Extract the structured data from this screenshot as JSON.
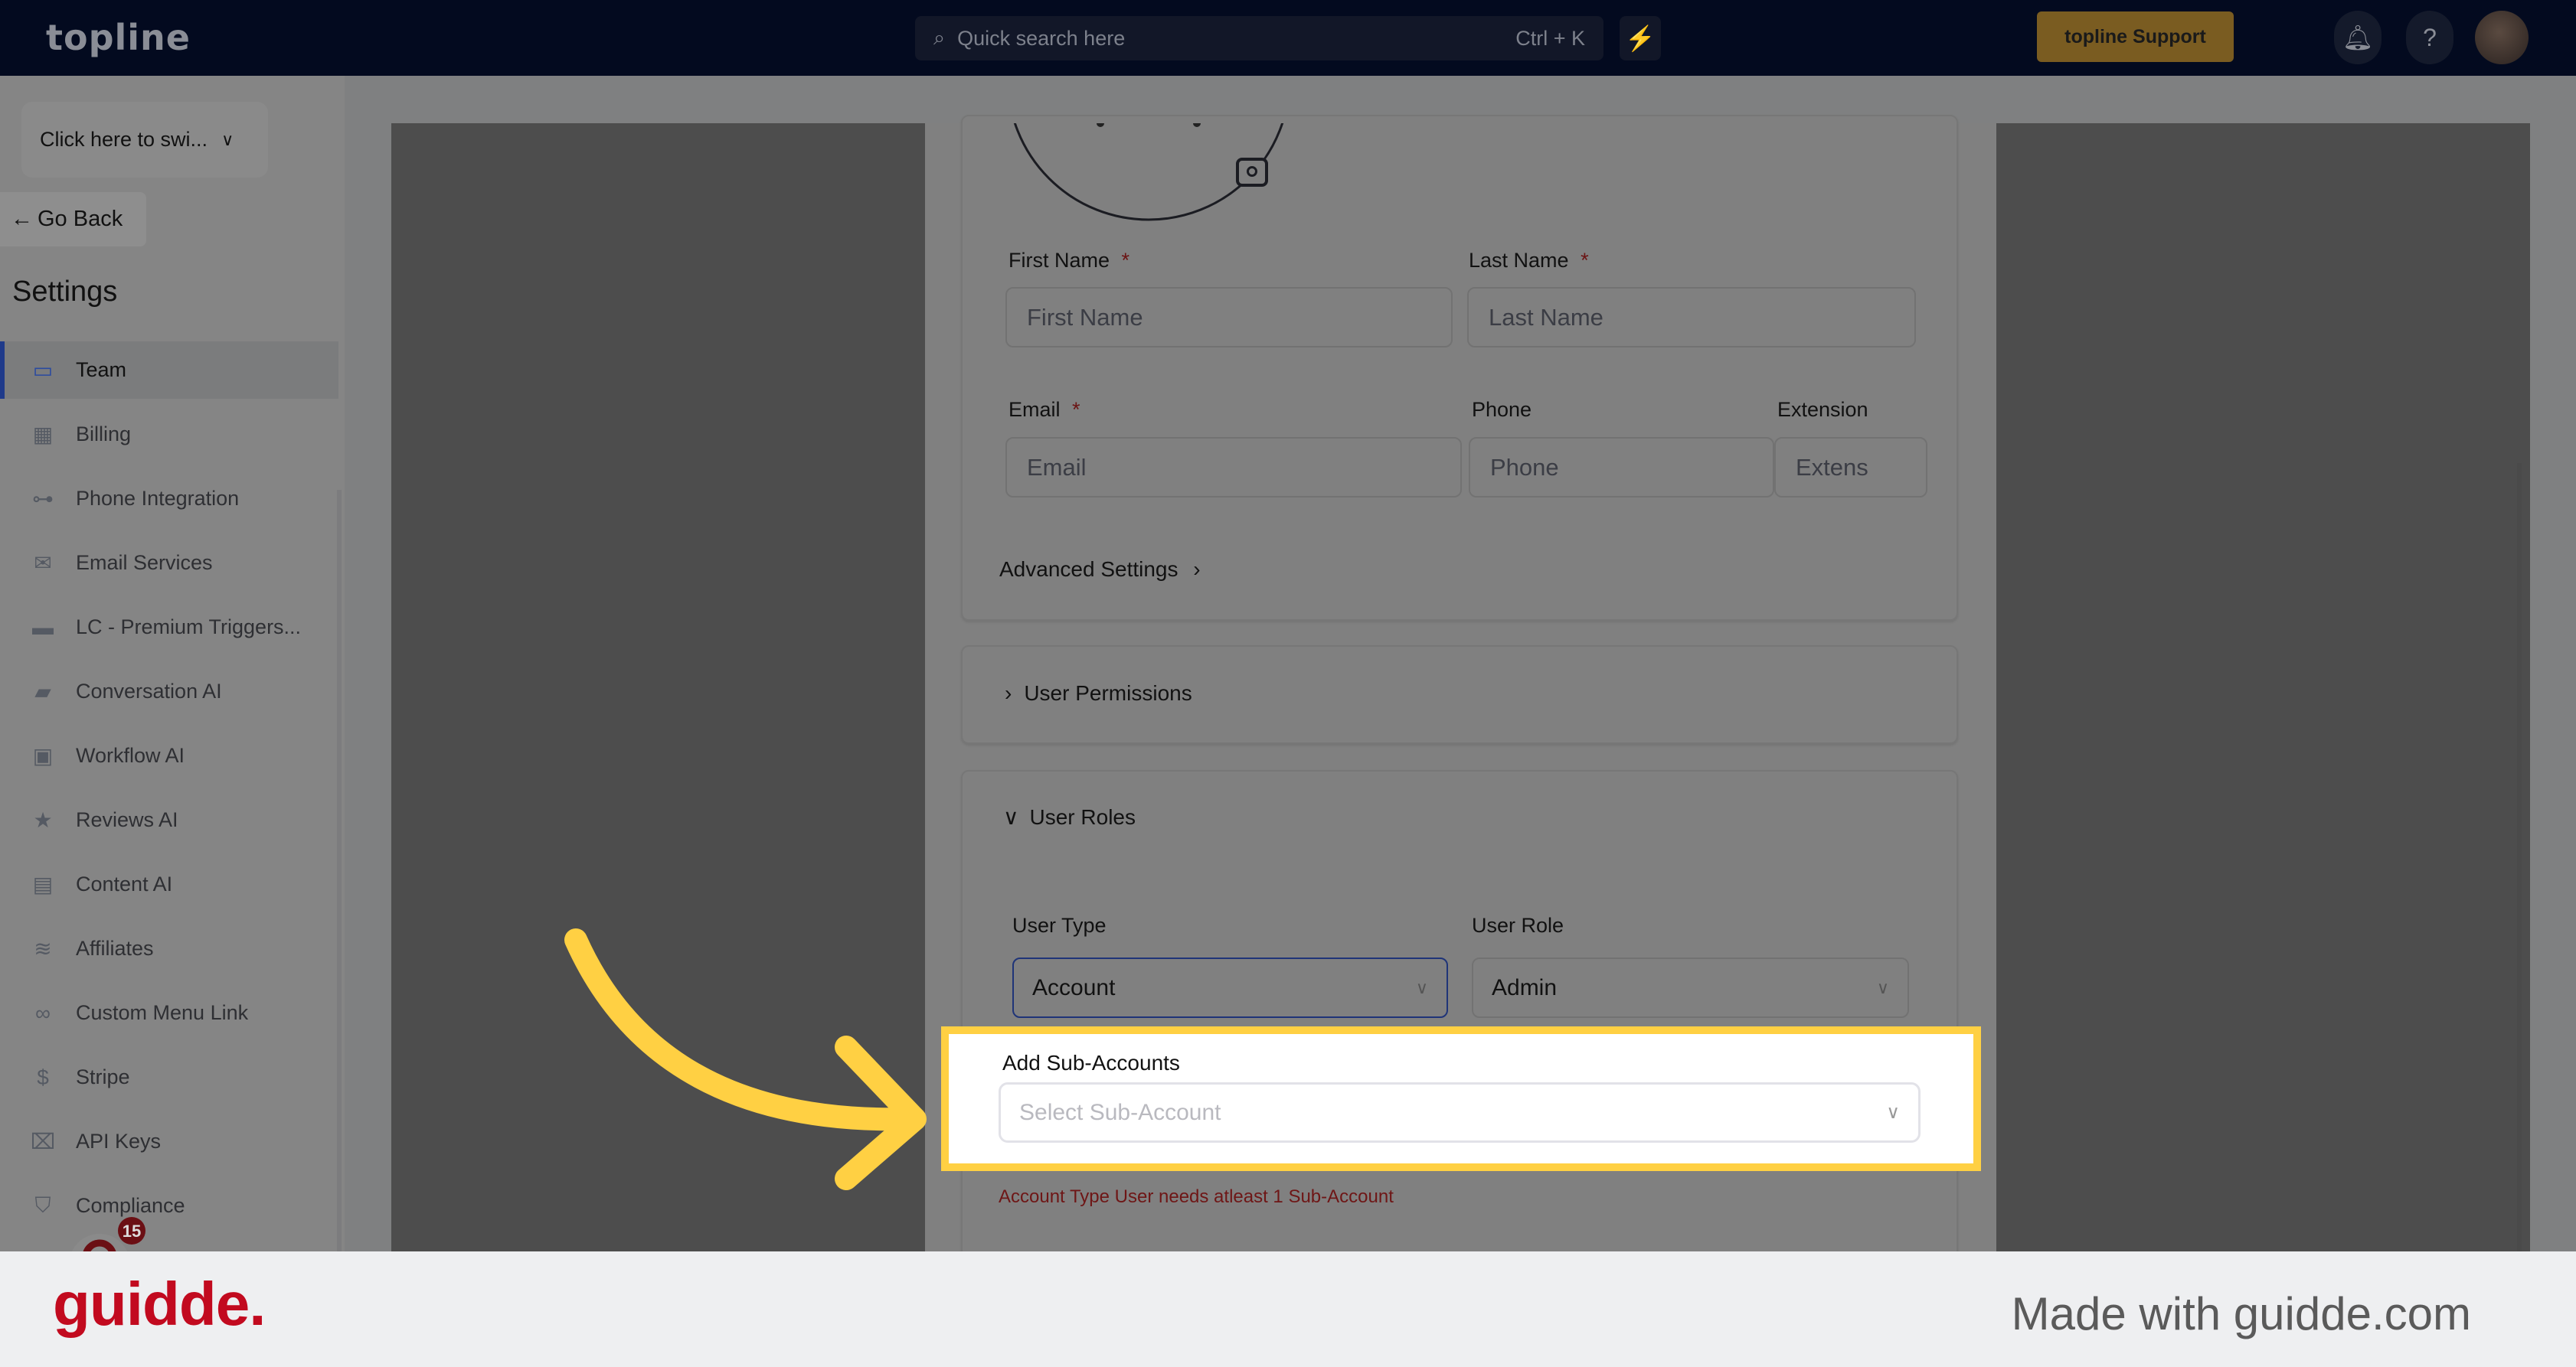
{
  "header": {
    "logo": "topline",
    "search_placeholder": "Quick search here",
    "search_shortcut": "Ctrl + K",
    "support_label": "topline Support"
  },
  "sidebar": {
    "switcher": "Click here to swi...",
    "go_back": "Go Back",
    "title": "Settings",
    "items": [
      {
        "label": "Team",
        "icon": "team-icon",
        "glyph": "▭",
        "active": true
      },
      {
        "label": "Billing",
        "icon": "calculator-icon",
        "glyph": "▦"
      },
      {
        "label": "Phone Integration",
        "icon": "integration-icon",
        "glyph": "⊶"
      },
      {
        "label": "Email Services",
        "icon": "mail-icon",
        "glyph": "✉"
      },
      {
        "label": "LC - Premium Triggers...",
        "icon": "store-icon",
        "glyph": "▬"
      },
      {
        "label": "Conversation AI",
        "icon": "chat-icon",
        "glyph": "▰"
      },
      {
        "label": "Workflow AI",
        "icon": "ai-chip-icon",
        "glyph": "▣"
      },
      {
        "label": "Reviews AI",
        "icon": "star-icon",
        "glyph": "★"
      },
      {
        "label": "Content AI",
        "icon": "content-icon",
        "glyph": "▤"
      },
      {
        "label": "Affiliates",
        "icon": "handshake-icon",
        "glyph": "≋"
      },
      {
        "label": "Custom Menu Link",
        "icon": "link-icon",
        "glyph": "∞"
      },
      {
        "label": "Stripe",
        "icon": "dollar-hand-icon",
        "glyph": "$"
      },
      {
        "label": "API Keys",
        "icon": "api-key-icon",
        "glyph": "⌧"
      },
      {
        "label": "Compliance",
        "icon": "shield-icon",
        "glyph": "⛉"
      }
    ],
    "badge_count": "15"
  },
  "form": {
    "first_name_label": "First Name",
    "first_name_placeholder": "First Name",
    "last_name_label": "Last Name",
    "last_name_placeholder": "Last Name",
    "email_label": "Email",
    "email_placeholder": "Email",
    "phone_label": "Phone",
    "phone_placeholder": "Phone",
    "extension_label": "Extension",
    "extension_placeholder": "Extens",
    "required_mark": "*",
    "advanced_settings": "Advanced Settings",
    "user_permissions": "User Permissions",
    "user_roles": "User Roles",
    "user_type_label": "User Type",
    "user_type_value": "Account",
    "user_role_label": "User Role",
    "user_role_value": "Admin",
    "sub_accounts_label": "Add Sub-Accounts",
    "sub_accounts_placeholder": "Select Sub-Account",
    "error": "Account Type User needs atleast 1 Sub-Account"
  },
  "colors": {
    "highlight": "#ffd043",
    "error": "#6e1616",
    "brand": "#c20a1f"
  },
  "footer": {
    "logo": "guidde.",
    "made_with": "Made with guidde.com"
  }
}
